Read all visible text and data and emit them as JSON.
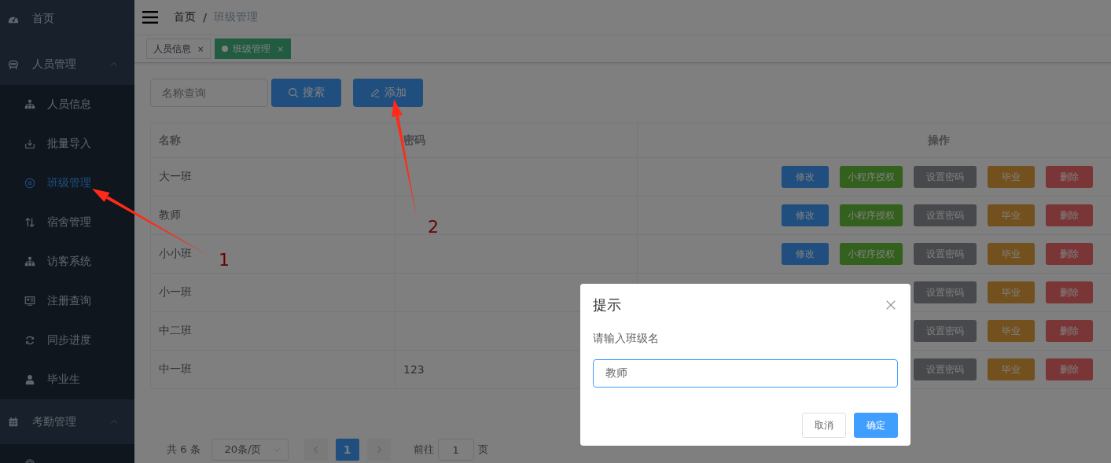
{
  "sidebar": {
    "items": [
      {
        "label": "首页",
        "selected": false
      },
      {
        "label": "人员管理",
        "expanded": true,
        "children": [
          {
            "label": "人员信息",
            "selected": false
          },
          {
            "label": "批量导入",
            "selected": false
          },
          {
            "label": "班级管理",
            "selected": true
          },
          {
            "label": "宿舍管理",
            "selected": false
          },
          {
            "label": "访客系统",
            "selected": false
          },
          {
            "label": "注册查询",
            "selected": false
          },
          {
            "label": "同步进度",
            "selected": false
          },
          {
            "label": "毕业生",
            "selected": false
          }
        ]
      },
      {
        "label": "考勤管理",
        "expanded": true,
        "children": [
          {
            "selected": false
          }
        ]
      }
    ]
  },
  "breadcrumb": [
    "首页",
    "班级管理"
  ],
  "breadcrumb_separator": "/",
  "tabs": [
    {
      "label": "人员信息",
      "selected": false,
      "close": "×"
    },
    {
      "label": "班级管理",
      "selected": true,
      "close": "×"
    }
  ],
  "toolbar": {
    "search": {
      "placeholder": "名称查询"
    },
    "buttons": [
      "搜索",
      "添加"
    ]
  },
  "table": {
    "columns": [
      "名称",
      "密码",
      "操作"
    ],
    "rows": [
      {
        "name": "大一班",
        "password": "",
        "actions": [
          {
            "label": "修改",
            "kind": "primary"
          },
          {
            "label": "小程序授权",
            "kind": "success"
          },
          {
            "label": "设置密码",
            "kind": "info"
          },
          {
            "label": "毕业",
            "kind": "warning"
          },
          {
            "label": "删除",
            "kind": "danger"
          }
        ]
      },
      {
        "name": "教师",
        "password": "",
        "actions": [
          {
            "label": "修改",
            "kind": "primary"
          },
          {
            "label": "小程序授权",
            "kind": "success"
          },
          {
            "label": "设置密码",
            "kind": "info"
          },
          {
            "label": "毕业",
            "kind": "warning"
          },
          {
            "label": "删除",
            "kind": "danger"
          }
        ]
      },
      {
        "name": "小小班",
        "password": "",
        "actions": [
          {
            "label": "修改",
            "kind": "primary"
          },
          {
            "label": "小程序授权",
            "kind": "success"
          },
          {
            "label": "设置密码",
            "kind": "info"
          },
          {
            "label": "毕业",
            "kind": "warning"
          },
          {
            "label": "删除",
            "kind": "danger"
          }
        ]
      },
      {
        "name": "小一班",
        "password": "",
        "actions": [
          {
            "label": "设置密码",
            "kind": "info"
          },
          {
            "label": "毕业",
            "kind": "warning"
          },
          {
            "label": "删除",
            "kind": "danger"
          }
        ]
      },
      {
        "name": "中二班",
        "password": "",
        "actions": [
          {
            "label": "设置密码",
            "kind": "info"
          },
          {
            "label": "毕业",
            "kind": "warning"
          },
          {
            "label": "删除",
            "kind": "danger"
          }
        ]
      },
      {
        "name": "中一班",
        "password": "123",
        "actions": [
          {
            "label": "设置密码",
            "kind": "info"
          },
          {
            "label": "毕业",
            "kind": "warning"
          },
          {
            "label": "删除",
            "kind": "danger"
          }
        ]
      }
    ]
  },
  "pagination": {
    "total": "共 6 条",
    "page_size": "20条/页",
    "pages": [
      {
        "label": "1",
        "selected": true
      }
    ],
    "goto_label": "前往",
    "goto_value": "1",
    "goto_suffix": "页"
  },
  "dialog": {
    "title": "提示",
    "message": "请输入班级名",
    "input_value": "教师",
    "buttons": [
      {
        "label": "取消",
        "kind": "default"
      },
      {
        "label": "确定",
        "kind": "primary"
      }
    ]
  },
  "annotations": [
    {
      "label": "1"
    },
    {
      "label": "2"
    }
  ]
}
